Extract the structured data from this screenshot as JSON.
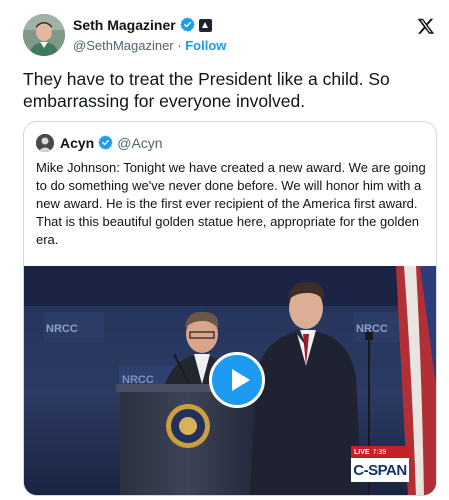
{
  "author": {
    "display_name": "Seth Magaziner",
    "handle": "@SethMagaziner",
    "follow_label": "Follow",
    "separator": "·"
  },
  "tweet": {
    "text": "They have to treat the President like a child. So embarrassing for everyone involved."
  },
  "quoted": {
    "display_name": "Acyn",
    "handle": "@Acyn",
    "text": "Mike Johnson: Tonight we have created a new award. We are going to do something we've never done before. We will honor him with a new award. He is the first ever recipient of the America first award. That is this beautiful golden statue here, appropriate for the golden era."
  },
  "video": {
    "live_label": "LIVE",
    "time": "7:39",
    "network": "C-SPAN",
    "stage_sign_left": "NRCC",
    "stage_sign_right": "NRCC"
  },
  "icons": {
    "brand": "x-logo-icon",
    "verified": "verified-badge-icon",
    "affiliation": "affiliation-badge-icon",
    "play": "play-icon"
  },
  "colors": {
    "accent": "#1d9bf0",
    "text": "#0f1419",
    "secondary_text": "#536471",
    "border": "#cfd9de",
    "live": "#c81e26",
    "cspan": "#123466"
  }
}
